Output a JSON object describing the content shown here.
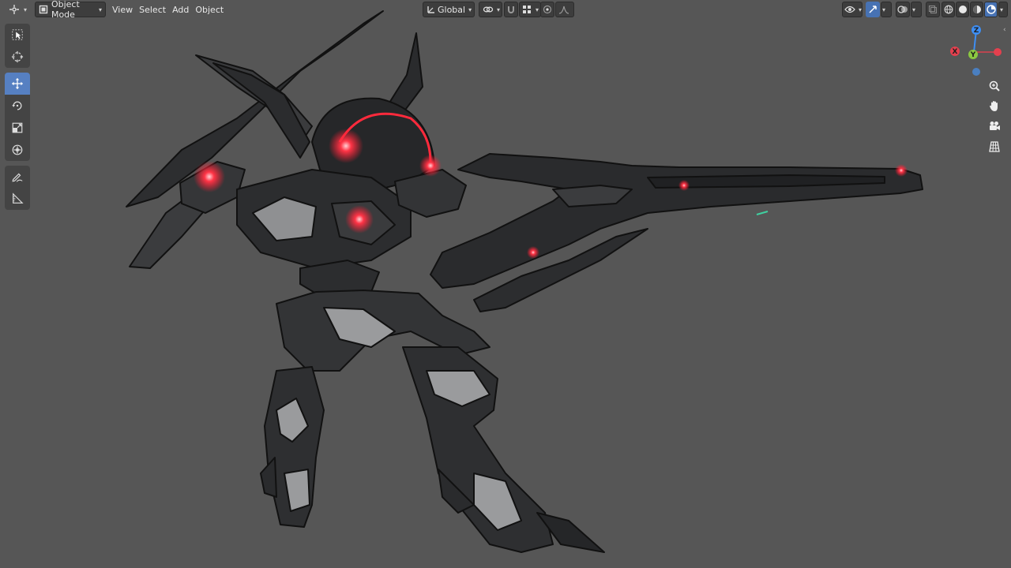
{
  "header": {
    "editor_type_icon": "3d-viewport-icon",
    "mode": "Object Mode",
    "menus": [
      "View",
      "Select",
      "Add",
      "Object"
    ],
    "transform_orientation": "Global",
    "pivot_icon": "pivot-link-icon",
    "snap_icon": "magnet-icon",
    "proportional_icon": "proportional-edit-icon",
    "right_icons": [
      "visibility-icon",
      "gizmo-toggle-icon",
      "overlay-icon",
      "xray-icon",
      "wireframe-shading",
      "solid-shading",
      "material-shading",
      "rendered-shading"
    ]
  },
  "toolbar": {
    "tools": [
      "select-box",
      "cursor",
      "move",
      "rotate",
      "scale",
      "transform",
      "annotate",
      "measure"
    ],
    "active": "move"
  },
  "gizmo": {
    "axes": [
      "X",
      "Y",
      "Z"
    ],
    "colors": {
      "x": "#e4404e",
      "y": "#8bc840",
      "z": "#3e8ef3",
      "neg_z": "#4a7fc0"
    }
  },
  "navigation": [
    "zoom-icon",
    "pan-hand-icon",
    "camera-icon",
    "grid-ortho-icon"
  ],
  "scene": {
    "object": "mecha-robot-with-rifle",
    "glow_color": "#ff2a3c",
    "body_color": "#2e2f31",
    "highlight_color": "#9a9a9a"
  }
}
